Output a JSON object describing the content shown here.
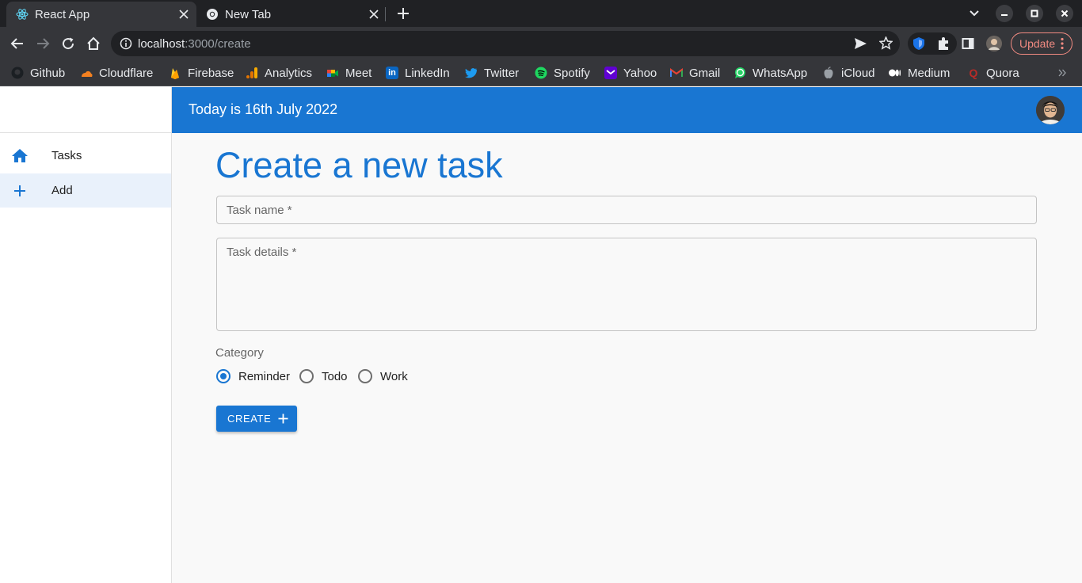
{
  "browser": {
    "tabs": [
      {
        "title": "React App",
        "active": true,
        "icon": "react-icon"
      },
      {
        "title": "New Tab",
        "active": false,
        "icon": "chrome-icon"
      }
    ],
    "url": {
      "host": "localhost",
      "path": ":3000/create"
    },
    "update_label": "Update",
    "bookmarks": [
      {
        "label": "Github",
        "icon": "github-icon"
      },
      {
        "label": "Cloudflare",
        "icon": "cloudflare-icon"
      },
      {
        "label": "Firebase",
        "icon": "firebase-icon"
      },
      {
        "label": "Analytics",
        "icon": "analytics-icon"
      },
      {
        "label": "Meet",
        "icon": "meet-icon"
      },
      {
        "label": "LinkedIn",
        "icon": "linkedin-icon"
      },
      {
        "label": "Twitter",
        "icon": "twitter-icon"
      },
      {
        "label": "Spotify",
        "icon": "spotify-icon"
      },
      {
        "label": "Yahoo",
        "icon": "yahoo-icon"
      },
      {
        "label": "Gmail",
        "icon": "gmail-icon"
      },
      {
        "label": "WhatsApp",
        "icon": "whatsapp-icon"
      },
      {
        "label": "iCloud",
        "icon": "icloud-icon"
      },
      {
        "label": "Medium",
        "icon": "medium-icon"
      },
      {
        "label": "Quora",
        "icon": "quora-icon"
      }
    ]
  },
  "app": {
    "header": {
      "date_text": "Today is 16th July 2022"
    },
    "sidebar": {
      "items": [
        {
          "label": "Tasks",
          "icon": "home-icon",
          "selected": false
        },
        {
          "label": "Add",
          "icon": "add-icon",
          "selected": true
        }
      ]
    },
    "form": {
      "title": "Create a new task",
      "task_name_placeholder": "Task name *",
      "task_details_placeholder": "Task details *",
      "category_label": "Category",
      "categories": [
        {
          "label": "Reminder",
          "checked": true
        },
        {
          "label": "Todo",
          "checked": false
        },
        {
          "label": "Work",
          "checked": false
        }
      ],
      "submit_label": "CREATE"
    }
  },
  "colors": {
    "primary": "#1976d2",
    "chrome_dark": "#202124",
    "chrome_toolbar": "#35363a",
    "update_accent": "#f28b82"
  }
}
